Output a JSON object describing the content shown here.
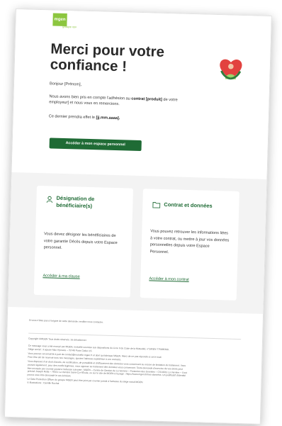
{
  "logo": {
    "text": "mgen",
    "tag": "groupe vyv"
  },
  "title": "Merci pour votre confiance !",
  "greeting": "Bonjour [Prénom],",
  "intro": {
    "p1": "Nous avons bien pris en compte l'adhésion au",
    "contract": "contrat [produit]",
    "p2": "de votre employeur] et nous vous en remercions.",
    "effect": "Ce dernier prendra effet le",
    "date": "[jj.mm.aaaa]."
  },
  "cta_label": "Accéder à mon espace personnel",
  "cards": [
    {
      "title": "Désignation de bénéficiaire(s)",
      "body": "Vous devez désigner les bénéficiaires de votre garantie Décès depuis votre Espace personnel.",
      "link": "Accéder à ma clause"
    },
    {
      "title": "Contrat et données",
      "body": "Vous pouvez retrouver les informations liées à votre contrat, ou mettre à jour vos données personnelles depuis votre Espace Personnel.",
      "link": "Accéder à mon contrat"
    }
  ],
  "footer": {
    "visible": "Si vous n'êtes pas à l'origine de cette demande, veuillez nous contacter.",
    "copyright": "Copyright ©MGEN Tous droits réservés. Se désabonner",
    "legal": [
      "Ce message vous a été envoyé par MGEN, mutuelle soumise aux dispositions du Livre II du Code de la Mutualité, n°SIREN 775685399.",
      "Siège social : 3 square Max Hymans – 75748 Paris Cedex 15.",
      "Vous pouvez cet email lié à part de contact@mutuelle-mgen.fr et dont qui fabrique MGEN. Merci de ne pas répondre à cet e-mail.",
      "Pour être sûr de recevoir tous nos messages, ajoutez l'adresse expéditrice à vos contacts.",
      "Vous disposez d'un droit d'accès, de rectification, de portabilité et d'effacement des données vous concernant ou encore de limitation du traitement. Vous",
      "pouvez également, pour des motifs légitimes, vous opposer au traitement des données vous concernant. Toute demande d'exercice de vos droits peut",
      "être envoyée par courrier postal à l'adresse suivante : MGEN – Centre de Gestion de La Verrière – Protection des Données – CS10031 La Verrière – Il est",
      "précisé Joseph Rolla – 78321 La Verrière Saint-Cyr-l'École, ou sur le site de MGEN à la page : https://www.mgen.fr/mes-données. Un justificatif d'identité",
      "pourra vous être demandé le cas échéant.",
      "Le Data Protection Officer du groupe MGEN peut être joint par courrier postal à l'adresse du siège social MGEN.",
      "© Illustrations : Camille Rochat"
    ]
  },
  "colors": {
    "brand_green": "#1f6b35",
    "logo_green": "#8cc63f",
    "heart_red": "#e2423f",
    "light_band": "#f3f3f3"
  }
}
